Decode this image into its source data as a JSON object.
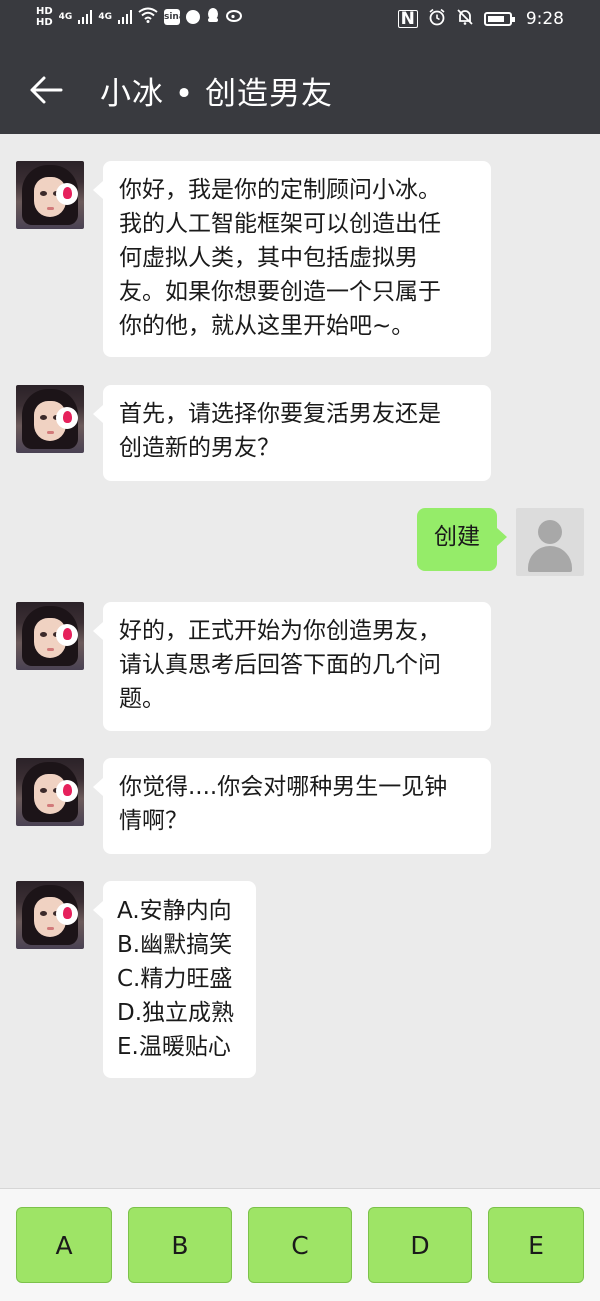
{
  "status_bar": {
    "hd1": "HD",
    "hd2": "HD",
    "net1": "4G",
    "net2": "4G",
    "nfc": "N",
    "time": "9:28"
  },
  "header": {
    "title": "小冰 • 创造男友",
    "back_icon": "arrow-left-icon"
  },
  "colors": {
    "header_bg": "#393a3f",
    "chat_bg": "#ebebeb",
    "user_bubble": "#95ec69",
    "option_button": "#9ee466"
  },
  "messages": [
    {
      "sender": "bot",
      "lines": [
        "你好，我是你的定制顾问小冰。",
        "我的人工智能框架可以创造出任",
        "何虚拟人类，其中包括虚拟男",
        "友。如果你想要创造一个只属于",
        "你的他，就从这里开始吧~。"
      ]
    },
    {
      "sender": "bot",
      "lines": [
        "首先，请选择你要复活男友还是",
        "创造新的男友？"
      ]
    },
    {
      "sender": "user",
      "lines": [
        "创建"
      ]
    },
    {
      "sender": "bot",
      "lines": [
        "好的，正式开始为你创造男友，",
        "请认真思考后回答下面的几个问",
        "题。"
      ]
    },
    {
      "sender": "bot",
      "lines": [
        "你觉得....你会对哪种男生一见钟",
        "情啊？"
      ]
    },
    {
      "sender": "bot",
      "lines": [
        "A.安静内向",
        "B.幽默搞笑",
        "C.精力旺盛",
        "D.独立成熟",
        "E.温暖贴心"
      ]
    }
  ],
  "options": [
    "A",
    "B",
    "C",
    "D",
    "E"
  ]
}
